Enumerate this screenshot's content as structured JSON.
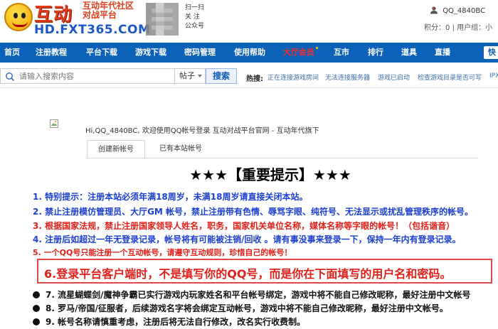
{
  "header": {
    "logo_text": "互动",
    "logo_slogan_line1": "互动年代社区",
    "logo_slogan_line2": "对战平台",
    "logo_domain": "HD.FXT365.COM",
    "qr_caption": [
      "扫一扫",
      "关 注",
      "公众号"
    ],
    "username": "QQ_4840BC",
    "points_label": "积分：0",
    "group_label": "用户组：小"
  },
  "nav": {
    "items": [
      "首页",
      "注册教程",
      "平台下载",
      "游戏下载",
      "密码管理",
      "使用帮助",
      "大厅会员",
      "互市",
      "排行",
      "道具",
      "直播"
    ],
    "last_label": "快"
  },
  "search": {
    "placeholder": "请输入搜索内容",
    "type_label": "帖子",
    "button_label": "搜索",
    "hot_label": "热搜:",
    "hot_links": [
      "正在连接游戏房间",
      "无法连接服务器",
      "游戏已启动",
      "检查游戏目录是否可写",
      "IPX"
    ]
  },
  "main": {
    "welcome_text": "Hi,QQ_4840BC, 欢迎使用QQ帐号登录 互动对战平台官网 - 互动年代旗下",
    "tabs": [
      "创建新帐号",
      "已有本站帐号"
    ],
    "notice_title": "★★★【重要提示】★★★",
    "rules": [
      "1. 特别提示：注册本站必须年满18周岁，未满18周岁请直接关闭本站。",
      "2. 禁止注册模仿管理员、大厅GM 帐号，禁止注册带有色情、辱骂字眼、纯符号、无法显示或扰乱管理秩序的帐号。",
      "3. 根据国家法规，禁止注册国家领导人姓名，职务，国家机关单位名称，媒体名称等字眼的帐号！（包括谐音）",
      "4. 注册后如超过一年无登录记录，帐号将有可能被注销/回收 。请有事没事来登录一下，保持一年内有登录记录。",
      "5. 一个QQ号只能注册一个互动帐号，请遵守互动规则，珍惜自己的帐号！"
    ],
    "highlight": "6.登录平台客户端时，不是填写你的QQ号，而是你在下面填写的用户名和密码。",
    "bullet_rules": [
      "7. 流星蝴蝶剑/魔神争霸已实行游戏内玩家姓名和平台帐号绑定，游戏中将不能自己修改昵称，最好注册中文帐号",
      "8. 罗马/帝国/征服者，后续游戏名字将会绑定互动帐号，游戏中将不能自己修改昵称，最好注册中文帐号。",
      "9. 帐号名称请慎重考虑，注册后将无法自行修改，改名实行收费制。"
    ]
  },
  "colors": {
    "nav_bg": "#0b62b8",
    "accent_red": "#e0201a",
    "accent_blue": "#1a3fd1"
  }
}
